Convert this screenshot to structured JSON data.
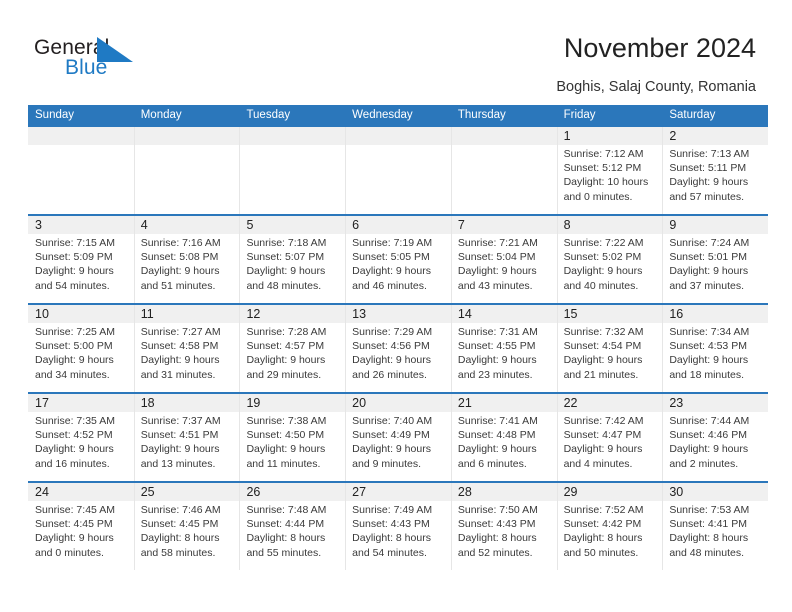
{
  "brand": {
    "name_part1": "General",
    "name_part2": "Blue",
    "logo_icon": "triangle-flag-icon",
    "color_blue": "#1f7ac4",
    "color_dark": "#231f20"
  },
  "header": {
    "title": "November 2024",
    "subtitle": "Boghis, Salaj County, Romania"
  },
  "theme": {
    "header_blue": "#2b77bb",
    "date_band_gray": "#f0f0f0",
    "text_color": "#3a3a3a"
  },
  "calendar": {
    "weekdays": [
      "Sunday",
      "Monday",
      "Tuesday",
      "Wednesday",
      "Thursday",
      "Friday",
      "Saturday"
    ],
    "labels": {
      "sunrise_prefix": "Sunrise:",
      "sunset_prefix": "Sunset:",
      "daylight_prefix": "Daylight:"
    },
    "weeks": [
      [
        {
          "day": "",
          "sunrise": "",
          "sunset": "",
          "daylight": ""
        },
        {
          "day": "",
          "sunrise": "",
          "sunset": "",
          "daylight": ""
        },
        {
          "day": "",
          "sunrise": "",
          "sunset": "",
          "daylight": ""
        },
        {
          "day": "",
          "sunrise": "",
          "sunset": "",
          "daylight": ""
        },
        {
          "day": "",
          "sunrise": "",
          "sunset": "",
          "daylight": ""
        },
        {
          "day": "1",
          "sunrise": "Sunrise: 7:12 AM",
          "sunset": "Sunset: 5:12 PM",
          "daylight": "Daylight: 10 hours and 0 minutes."
        },
        {
          "day": "2",
          "sunrise": "Sunrise: 7:13 AM",
          "sunset": "Sunset: 5:11 PM",
          "daylight": "Daylight: 9 hours and 57 minutes."
        }
      ],
      [
        {
          "day": "3",
          "sunrise": "Sunrise: 7:15 AM",
          "sunset": "Sunset: 5:09 PM",
          "daylight": "Daylight: 9 hours and 54 minutes."
        },
        {
          "day": "4",
          "sunrise": "Sunrise: 7:16 AM",
          "sunset": "Sunset: 5:08 PM",
          "daylight": "Daylight: 9 hours and 51 minutes."
        },
        {
          "day": "5",
          "sunrise": "Sunrise: 7:18 AM",
          "sunset": "Sunset: 5:07 PM",
          "daylight": "Daylight: 9 hours and 48 minutes."
        },
        {
          "day": "6",
          "sunrise": "Sunrise: 7:19 AM",
          "sunset": "Sunset: 5:05 PM",
          "daylight": "Daylight: 9 hours and 46 minutes."
        },
        {
          "day": "7",
          "sunrise": "Sunrise: 7:21 AM",
          "sunset": "Sunset: 5:04 PM",
          "daylight": "Daylight: 9 hours and 43 minutes."
        },
        {
          "day": "8",
          "sunrise": "Sunrise: 7:22 AM",
          "sunset": "Sunset: 5:02 PM",
          "daylight": "Daylight: 9 hours and 40 minutes."
        },
        {
          "day": "9",
          "sunrise": "Sunrise: 7:24 AM",
          "sunset": "Sunset: 5:01 PM",
          "daylight": "Daylight: 9 hours and 37 minutes."
        }
      ],
      [
        {
          "day": "10",
          "sunrise": "Sunrise: 7:25 AM",
          "sunset": "Sunset: 5:00 PM",
          "daylight": "Daylight: 9 hours and 34 minutes."
        },
        {
          "day": "11",
          "sunrise": "Sunrise: 7:27 AM",
          "sunset": "Sunset: 4:58 PM",
          "daylight": "Daylight: 9 hours and 31 minutes."
        },
        {
          "day": "12",
          "sunrise": "Sunrise: 7:28 AM",
          "sunset": "Sunset: 4:57 PM",
          "daylight": "Daylight: 9 hours and 29 minutes."
        },
        {
          "day": "13",
          "sunrise": "Sunrise: 7:29 AM",
          "sunset": "Sunset: 4:56 PM",
          "daylight": "Daylight: 9 hours and 26 minutes."
        },
        {
          "day": "14",
          "sunrise": "Sunrise: 7:31 AM",
          "sunset": "Sunset: 4:55 PM",
          "daylight": "Daylight: 9 hours and 23 minutes."
        },
        {
          "day": "15",
          "sunrise": "Sunrise: 7:32 AM",
          "sunset": "Sunset: 4:54 PM",
          "daylight": "Daylight: 9 hours and 21 minutes."
        },
        {
          "day": "16",
          "sunrise": "Sunrise: 7:34 AM",
          "sunset": "Sunset: 4:53 PM",
          "daylight": "Daylight: 9 hours and 18 minutes."
        }
      ],
      [
        {
          "day": "17",
          "sunrise": "Sunrise: 7:35 AM",
          "sunset": "Sunset: 4:52 PM",
          "daylight": "Daylight: 9 hours and 16 minutes."
        },
        {
          "day": "18",
          "sunrise": "Sunrise: 7:37 AM",
          "sunset": "Sunset: 4:51 PM",
          "daylight": "Daylight: 9 hours and 13 minutes."
        },
        {
          "day": "19",
          "sunrise": "Sunrise: 7:38 AM",
          "sunset": "Sunset: 4:50 PM",
          "daylight": "Daylight: 9 hours and 11 minutes."
        },
        {
          "day": "20",
          "sunrise": "Sunrise: 7:40 AM",
          "sunset": "Sunset: 4:49 PM",
          "daylight": "Daylight: 9 hours and 9 minutes."
        },
        {
          "day": "21",
          "sunrise": "Sunrise: 7:41 AM",
          "sunset": "Sunset: 4:48 PM",
          "daylight": "Daylight: 9 hours and 6 minutes."
        },
        {
          "day": "22",
          "sunrise": "Sunrise: 7:42 AM",
          "sunset": "Sunset: 4:47 PM",
          "daylight": "Daylight: 9 hours and 4 minutes."
        },
        {
          "day": "23",
          "sunrise": "Sunrise: 7:44 AM",
          "sunset": "Sunset: 4:46 PM",
          "daylight": "Daylight: 9 hours and 2 minutes."
        }
      ],
      [
        {
          "day": "24",
          "sunrise": "Sunrise: 7:45 AM",
          "sunset": "Sunset: 4:45 PM",
          "daylight": "Daylight: 9 hours and 0 minutes."
        },
        {
          "day": "25",
          "sunrise": "Sunrise: 7:46 AM",
          "sunset": "Sunset: 4:45 PM",
          "daylight": "Daylight: 8 hours and 58 minutes."
        },
        {
          "day": "26",
          "sunrise": "Sunrise: 7:48 AM",
          "sunset": "Sunset: 4:44 PM",
          "daylight": "Daylight: 8 hours and 55 minutes."
        },
        {
          "day": "27",
          "sunrise": "Sunrise: 7:49 AM",
          "sunset": "Sunset: 4:43 PM",
          "daylight": "Daylight: 8 hours and 54 minutes."
        },
        {
          "day": "28",
          "sunrise": "Sunrise: 7:50 AM",
          "sunset": "Sunset: 4:43 PM",
          "daylight": "Daylight: 8 hours and 52 minutes."
        },
        {
          "day": "29",
          "sunrise": "Sunrise: 7:52 AM",
          "sunset": "Sunset: 4:42 PM",
          "daylight": "Daylight: 8 hours and 50 minutes."
        },
        {
          "day": "30",
          "sunrise": "Sunrise: 7:53 AM",
          "sunset": "Sunset: 4:41 PM",
          "daylight": "Daylight: 8 hours and 48 minutes."
        }
      ]
    ]
  }
}
